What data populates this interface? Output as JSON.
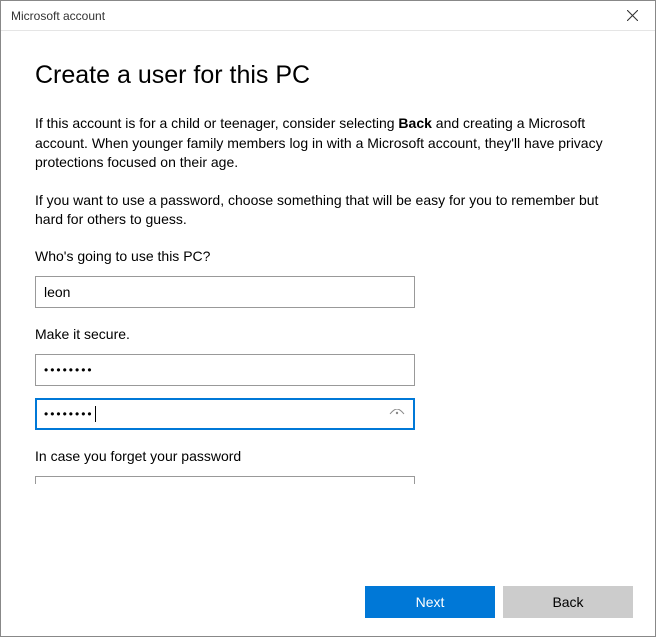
{
  "window": {
    "title": "Microsoft account"
  },
  "heading": "Create a user for this PC",
  "para1_a": "If this account is for a child or teenager, consider selecting ",
  "para1_bold": "Back",
  "para1_b": " and creating a Microsoft account. When younger family members log in with a Microsoft account, they'll have privacy protections focused on their age.",
  "para2": "If you want to use a password, choose something that will be easy for you to remember but hard for others to guess.",
  "labels": {
    "username": "Who's going to use this PC?",
    "secure": "Make it secure.",
    "forgot": "In case you forget your password"
  },
  "fields": {
    "username": "leon",
    "password": "••••••••",
    "confirm": "••••••••"
  },
  "buttons": {
    "next": "Next",
    "back": "Back"
  }
}
